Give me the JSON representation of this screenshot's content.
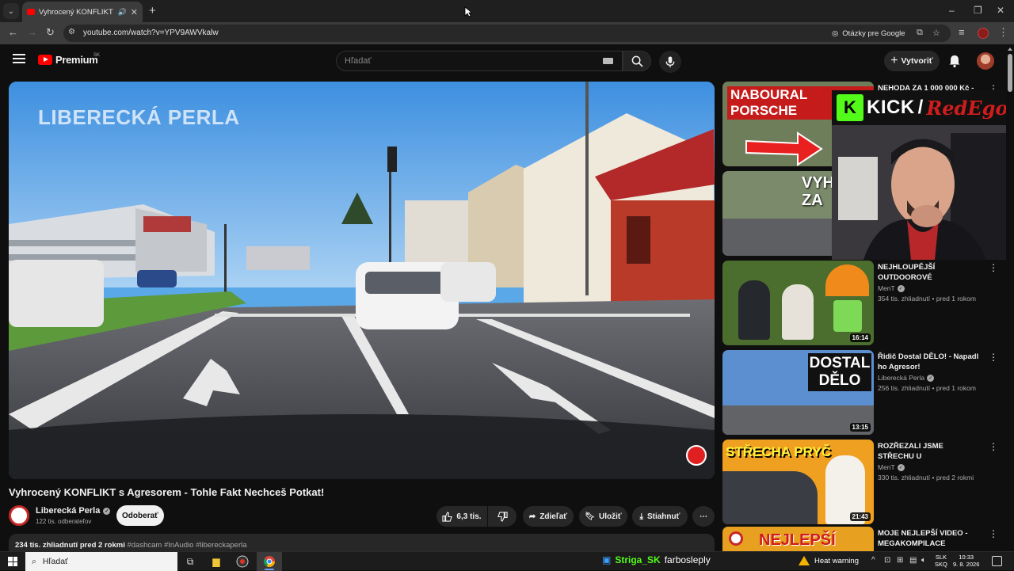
{
  "browser": {
    "tab_title": "Vyhrocený KONFLIKT s Agr",
    "url": "youtube.com/watch?v=YPV9AWVkalw",
    "lens_label": "Otázky pre Google"
  },
  "header": {
    "logo_text": "Premium",
    "country": "SK",
    "search_placeholder": "Hľadať",
    "create_label": "Vytvoriť"
  },
  "player": {
    "watermark": "LIBERECKÁ PERLA"
  },
  "video": {
    "title": "Vyhrocený KONFLIKT s Agresorem - Tohle Fakt Nechceš Potkat!",
    "channel": "Liberecká Perla",
    "subscribers": "122 tis. odberateľov",
    "subscribe_label": "Odoberať",
    "likes": "6,3 tis.",
    "share_label": "Zdieľať",
    "save_label": "Uložiť",
    "download_label": "Stiahnuť",
    "views_date": "234 tis. zhliadnutí  pred 2 rokmi",
    "hashtags": "#dashcam #InAudio #libereckaperla"
  },
  "recommendations": [
    {
      "title": "NEHODA ZA 1 000 000 Kč -",
      "channel": "",
      "meta": "",
      "duration": "",
      "thumb_text": "NABOURAL PORSCHE"
    },
    {
      "title": "",
      "channel": "",
      "meta": "",
      "duration": "",
      "thumb_text": "VYHRO ZA"
    },
    {
      "title": "NEJHLOUPĚJŠÍ OUTDOOROVÉ VYCHYTÁVKY Z TEMU!",
      "channel": "MenT",
      "meta": "354 tis. zhliadnutí • pred 1 rokom",
      "duration": "16:14",
      "thumb_text": ""
    },
    {
      "title": "Řidič Dostal DĚLO! - Napadl ho Agresor!",
      "channel": "Liberecká Perla",
      "meta": "256 tis. zhliadnutí • pred 1 rokom",
      "duration": "13:15",
      "thumb_text": "DOSTAL DĚLO"
    },
    {
      "title": "ROZŘEZALI JSME STŘECHU U NEJLEVNĚJŠÍHO KABRIOLET...",
      "channel": "MenT",
      "meta": "330 tis. zhliadnutí • pred 2 rokmi",
      "duration": "21:43",
      "thumb_text": "STŘECHA PRYČ"
    },
    {
      "title": "MOJE NEJLEPŠÍ VIDEO - MEGAKOMPILACE",
      "channel": "",
      "meta": "",
      "duration": "",
      "thumb_text": "NEJLEPŠÍ"
    }
  ],
  "overlay": {
    "kick_letter": "K",
    "kick_word": "KICK",
    "slash": "/",
    "streamer": "RedEgo"
  },
  "taskbar": {
    "search_placeholder": "Hľadať",
    "ticker_user": "Striga_SK",
    "ticker_message": "farbosleply",
    "weather": "Heat warning",
    "lang_top": "SLK",
    "lang_bottom": "SKQ",
    "time": "10:33",
    "date": "9. 8. 2026"
  },
  "colors": {
    "yt_red": "#ff0000",
    "kick_green": "#53fc18",
    "background": "#0f0f0f"
  }
}
